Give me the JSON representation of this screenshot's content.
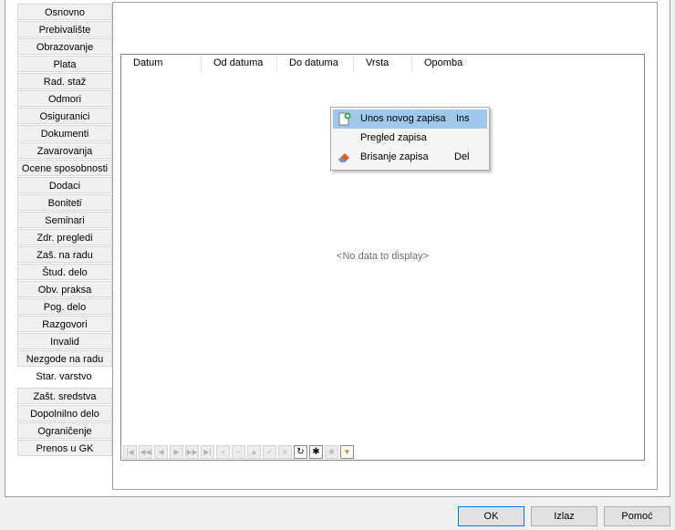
{
  "tabs": [
    {
      "label": "Osnovno"
    },
    {
      "label": "Prebivalište"
    },
    {
      "label": "Obrazovanje"
    },
    {
      "label": "Plata"
    },
    {
      "label": "Rad. staž"
    },
    {
      "label": "Odmori"
    },
    {
      "label": "Osiguranici"
    },
    {
      "label": "Dokumenti"
    },
    {
      "label": "Zavarovanja"
    },
    {
      "label": "Ocene sposobnosti"
    },
    {
      "label": "Dodaci"
    },
    {
      "label": "Boniteti"
    },
    {
      "label": "Seminari"
    },
    {
      "label": "Zdr. pregledi"
    },
    {
      "label": "Zaš. na radu"
    },
    {
      "label": "Štud. delo"
    },
    {
      "label": "Obv. praksa"
    },
    {
      "label": "Pog. delo"
    },
    {
      "label": "Razgovori"
    },
    {
      "label": "Invalid"
    },
    {
      "label": "Nezgode na radu"
    },
    {
      "label": "Star. varstvo"
    },
    {
      "label": "Zašt. sredstva"
    },
    {
      "label": "Dopolnilno delo"
    },
    {
      "label": "Ograničenje"
    },
    {
      "label": "Prenos u GK"
    }
  ],
  "active_tab": "Star. varstvo",
  "grid": {
    "columns": [
      "Datum",
      "Od datuma",
      "Do datuma",
      "Vrsta",
      "Opomba"
    ],
    "empty_text": "<No data to display>"
  },
  "context_menu": {
    "items": [
      {
        "label": "Unos novog zapisa",
        "shortcut": "Ins",
        "icon": "add-record-icon",
        "highlighted": true
      },
      {
        "label": "Pregled zapisa",
        "shortcut": "",
        "icon": "",
        "highlighted": false
      },
      {
        "label": "Brisanje zapisa",
        "shortcut": "Del",
        "icon": "eraser-icon",
        "highlighted": false
      }
    ]
  },
  "navigator": {
    "buttons": [
      "first",
      "prev-page",
      "prev",
      "next",
      "next-page",
      "last",
      "insert",
      "delete",
      "edit",
      "post",
      "cancel",
      "refresh",
      "bookmark",
      "goto-bookmark",
      "filter"
    ]
  },
  "buttons": {
    "ok": "OK",
    "exit": "Izlaz",
    "help": "Pomoć"
  }
}
